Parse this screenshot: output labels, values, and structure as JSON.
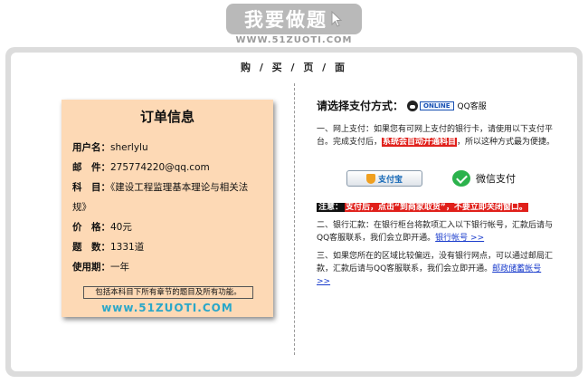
{
  "logo": {
    "text": "我要做题",
    "url": "WWW.51ZUOTI.COM"
  },
  "page_title": "购 / 买 / 页 / 面",
  "order": {
    "title": "订单信息",
    "fields": [
      {
        "label": "用户名：",
        "value": "sherlylu"
      },
      {
        "label": "邮　件：",
        "value": "275774220@qq.com"
      },
      {
        "label": "科　目：",
        "value": "《建设工程监理基本理论与相关法"
      },
      {
        "label": "",
        "value": "规》"
      },
      {
        "label": "价　格：",
        "value": "40元"
      },
      {
        "label": "题　数：",
        "value": "1331道"
      },
      {
        "label": "使用期：",
        "value": "一年"
      }
    ],
    "note": "包括本科目下所有章节的题目及所有功能。",
    "site_url": "www.51ZUOTI.COM"
  },
  "payment": {
    "heading": "请选择支付方式：",
    "online_badge": "ONLINE",
    "qq_label": "QQ客服",
    "p1_a": "一、网上支付：如果您有可网上支付的银行卡，请使用以下支付平台。完成支付后，",
    "p1_hl": "系统会自动开通科目",
    "p1_b": "，所以这种方式最为便捷。",
    "alipay_label": "支付宝",
    "wechat_label": "微信支付",
    "notice_label": "注意：",
    "notice_text": "支付后，点击“到商家取货”，不要立即关闭窗口。",
    "p2_a": "二、银行汇款：在银行柜台将款项汇入以下银行帐号，汇款后请与QQ客服联系，我们会立即开通。",
    "p2_link": "银行帐号 >>",
    "p3_a": "三、如果您所在的区域比较偏远，没有银行网点，可以通过邮局汇款，汇款后请与QQ客服联系，我们会立即开通。",
    "p3_link_a": "邮政储蓄帐",
    "p3_link_b": "号 >>"
  },
  "colors": {
    "card_bg": "#fdd9b5",
    "highlight": "#e0201b",
    "link": "#1a3ccc",
    "wechat": "#2bb24c"
  }
}
